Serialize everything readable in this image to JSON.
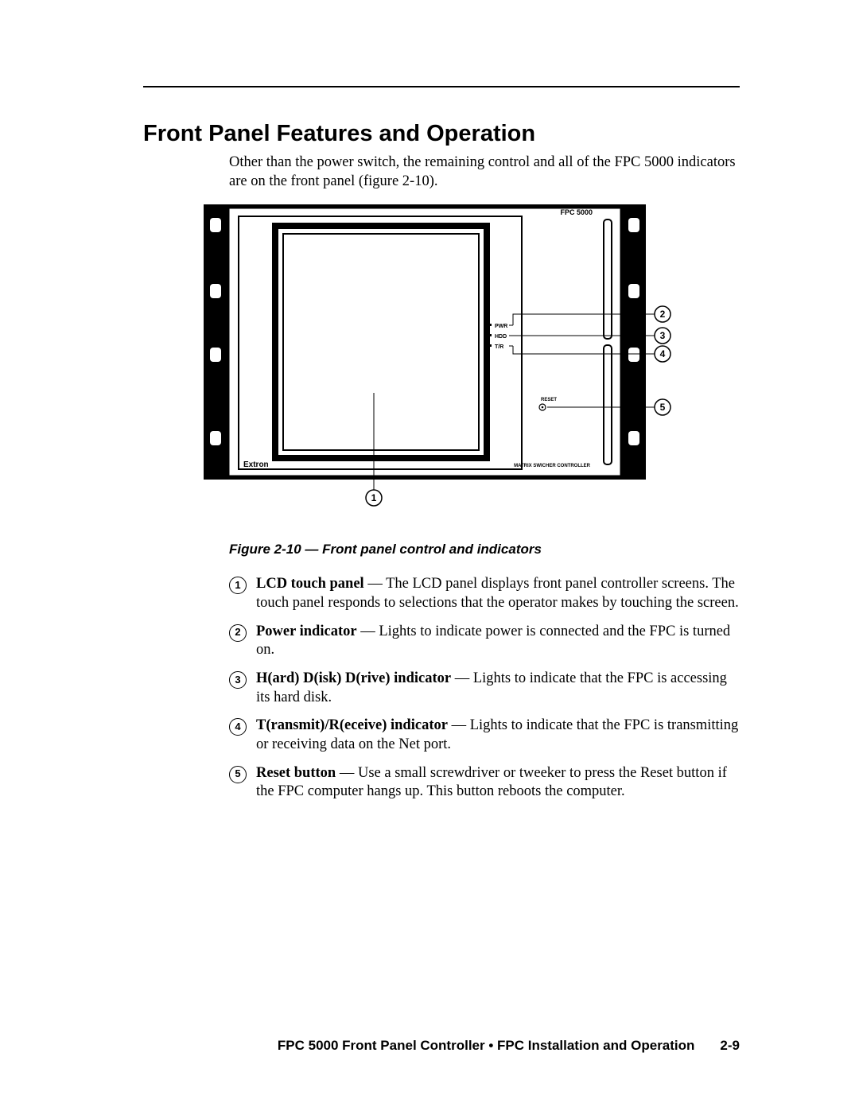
{
  "heading": "Front Panel Features and Operation",
  "intro": "Other than the power switch, the remaining control and all of the FPC 5000 indicators are on the front panel (figure 2-10).",
  "figure": {
    "caption": "Figure 2-10 — Front panel control and indicators",
    "labels": {
      "model": "FPC 5000",
      "brand": "Extron",
      "subtitle": "MATRIX  SWICHER CONTROLLER",
      "pwr": "PWR",
      "hdd": "HDD",
      "tr": "T/R",
      "reset": "RESET"
    },
    "callouts": [
      "1",
      "2",
      "3",
      "4",
      "5"
    ]
  },
  "items": [
    {
      "n": "1",
      "term": "LCD touch panel",
      "desc": " — The LCD panel displays front panel controller screens. The touch panel responds to selections that the operator makes by touching the screen."
    },
    {
      "n": "2",
      "term": "Power indicator",
      "desc": " — Lights to indicate power is connected and the FPC is turned on."
    },
    {
      "n": "3",
      "term": "H(ard) D(isk) D(rive) indicator",
      "desc": " — Lights to indicate that the FPC is accessing its hard disk."
    },
    {
      "n": "4",
      "term": "T(ransmit)/R(eceive) indicator",
      "desc": " — Lights to indicate that the FPC is transmitting or receiving data on the Net port."
    },
    {
      "n": "5",
      "term": "Reset button",
      "desc": " — Use a small screwdriver or tweeker to press the Reset button if the FPC computer hangs up.  This button reboots the computer."
    }
  ],
  "footer": {
    "text": "FPC 5000 Front Panel Controller • FPC Installation and Operation",
    "page": "2-9"
  }
}
